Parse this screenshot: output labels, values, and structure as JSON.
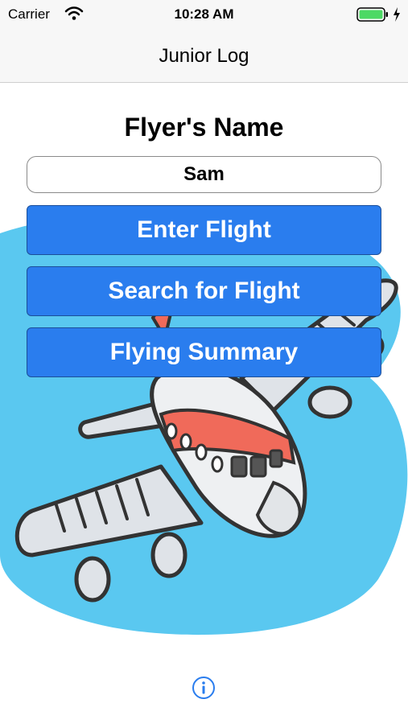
{
  "status_bar": {
    "carrier": "Carrier",
    "time": "10:28 AM",
    "battery_color": "#4cd964"
  },
  "nav": {
    "title": "Junior Log"
  },
  "form": {
    "flyer_label": "Flyer's Name",
    "name_value": "Sam"
  },
  "actions": {
    "enter_flight": "Enter Flight",
    "search_flight": "Search for Flight",
    "flying_summary": "Flying Summary"
  },
  "icons": {
    "info": "info-icon",
    "wifi": "wifi-icon",
    "battery": "battery-icon",
    "background": "airplane-illustration"
  },
  "colors": {
    "button_blue": "#2a7dee",
    "sky": "#5ac8f0",
    "plane_red": "#f06a5a",
    "info_blue": "#2a7dee"
  }
}
